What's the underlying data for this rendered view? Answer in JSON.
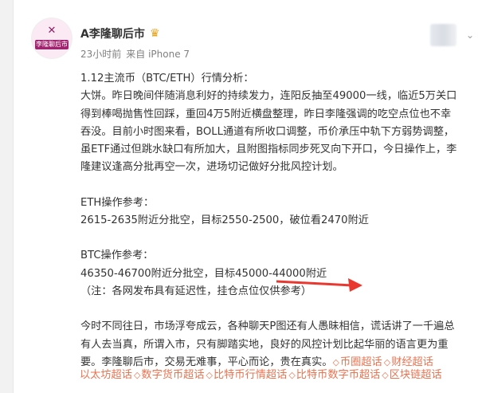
{
  "post": {
    "avatar_text": "李隆聊后市",
    "user_name": "A李隆聊后市",
    "time": "23小时前",
    "source": "来自 iPhone 7",
    "lines": [
      "1.12主流币（BTC/ETH）行情分析：",
      "大饼。昨日晚间伴随消息利好的持续发力，连阳反抽至49000一线，临近5万关口",
      "得到棒喝抛售性回踩，重回4万5附近横盘整理，昨日李隆强调的吃空点位也不幸",
      "吞没。目前小时图来看，BOLL通道有所收口调整，币价承压中轨下方弱势调整，",
      "虽ETF通过但跳水缺口有所加大，且附图指标同步死叉向下开口，今日操作上，李",
      "隆建议逢高分批再空一次，进场切记做好分批风控计划。",
      "",
      "ETH操作参考：",
      "2615-2635附近分批空，目标2550-2500，破位看2470附近",
      "",
      "BTC操作参考：",
      "46350-46700附近分批空，目标45000-44000附近",
      "（注：各网发布具有延迟性，挂仓点位仅供参考）",
      "",
      "今时不同往日，市场浮夸成云，各种聊天P图还有人愚昧相信，谎话讲了一千遍总",
      "有人去当真，所谓入市，只有脚踏实地，良好的风控计划比起华丽的语言更为重",
      "要。李隆聊后市，交易无难事，平心而论，贵在真实。"
    ],
    "inline_tags": [
      "币圈超话",
      "财经超话"
    ],
    "tag_line": [
      "以太坊超话",
      "数字货币超话",
      "比特币行情超话",
      "比特币数字币超话",
      "区块链超话"
    ]
  },
  "colors": {
    "tag": "#eb7350",
    "arrow": "#e8382f",
    "text": "#333333",
    "meta": "#808080"
  },
  "icons": {
    "badge": "crown-icon",
    "expand": "chevron-down-icon",
    "tag": "diamond-icon"
  }
}
